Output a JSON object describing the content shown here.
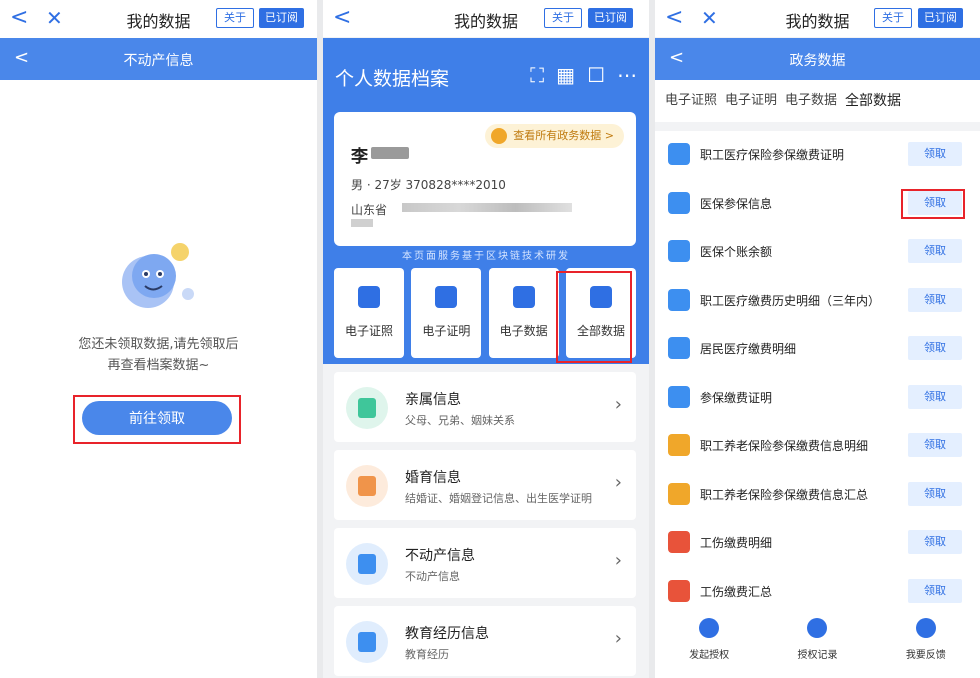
{
  "panel1": {
    "topbar": {
      "title": "我的数据",
      "about": "关于",
      "subscribed": "已订阅"
    },
    "subheader": {
      "title": "不动产信息"
    },
    "message_line1": "您还未领取数据,请先领取后",
    "message_line2": "再查看档案数据~",
    "go_button": "前往领取"
  },
  "panel2": {
    "topbar": {
      "title": "我的数据",
      "about": "关于",
      "subscribed": "已订阅"
    },
    "hero_title": "个人数据档案",
    "card": {
      "name": "李",
      "detail": "男 · 27岁  370828****2010",
      "address_prefix": "山东省",
      "gov_link": "查看所有政务数据 >"
    },
    "chain_note": "本页面服务基于区块链技术研发",
    "grid": [
      {
        "label": "电子证照"
      },
      {
        "label": "电子证明"
      },
      {
        "label": "电子数据"
      },
      {
        "label": "全部数据"
      }
    ],
    "rows": [
      {
        "title": "亲属信息",
        "sub": "父母、兄弟、姻妹关系",
        "color": "#3fc69a",
        "bg": "#dff5ec"
      },
      {
        "title": "婚育信息",
        "sub": "结婚证、婚姻登记信息、出生医学证明",
        "color": "#f0944a",
        "bg": "#fdebdc"
      },
      {
        "title": "不动产信息",
        "sub": "不动产信息",
        "color": "#3d8ff0",
        "bg": "#e0edfd"
      },
      {
        "title": "教育经历信息",
        "sub": "教育经历",
        "color": "#3d8ff0",
        "bg": "#e0edfd"
      }
    ]
  },
  "panel3": {
    "topbar": {
      "title": "我的数据",
      "about": "关于",
      "subscribed": "已订阅"
    },
    "subheader": {
      "title": "政务数据"
    },
    "tabs": [
      {
        "label": "电子证照"
      },
      {
        "label": "电子证明"
      },
      {
        "label": "电子数据"
      },
      {
        "label": "全部数据"
      }
    ],
    "items": [
      {
        "label": "职工医疗保险参保缴费证明",
        "btn": "领取",
        "color": "#3d8ff0"
      },
      {
        "label": "医保参保信息",
        "btn": "领取",
        "color": "#3d8ff0"
      },
      {
        "label": "医保个账余额",
        "btn": "领取",
        "color": "#3d8ff0"
      },
      {
        "label": "职工医疗缴费历史明细（三年内）",
        "btn": "领取",
        "color": "#3d8ff0"
      },
      {
        "label": "居民医疗缴费明细",
        "btn": "领取",
        "color": "#3d8ff0"
      },
      {
        "label": "参保缴费证明",
        "btn": "领取",
        "color": "#3d8ff0"
      },
      {
        "label": "职工养老保险参保缴费信息明细",
        "btn": "领取",
        "color": "#f0a72a"
      },
      {
        "label": "职工养老保险参保缴费信息汇总",
        "btn": "领取",
        "color": "#f0a72a"
      },
      {
        "label": "工伤缴费明细",
        "btn": "领取",
        "color": "#e8533a"
      },
      {
        "label": "工伤缴费汇总",
        "btn": "领取",
        "color": "#e8533a"
      }
    ],
    "footer": [
      {
        "label": "发起授权"
      },
      {
        "label": "授权记录"
      },
      {
        "label": "我要反馈"
      }
    ]
  }
}
